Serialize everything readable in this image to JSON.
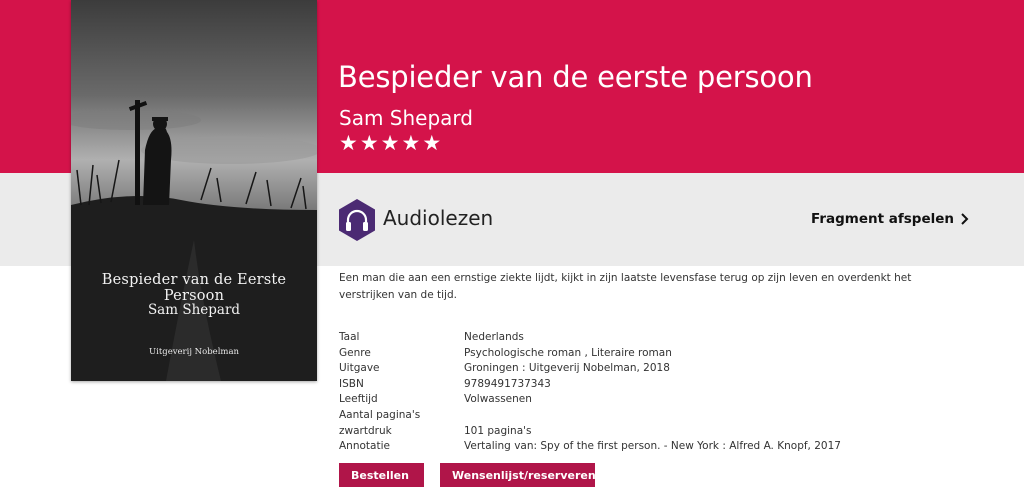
{
  "book": {
    "title": "Bespieder van de eerste persoon",
    "author": "Sam Shepard",
    "rating_stars": 5
  },
  "cover": {
    "title": "Bespieder van de Eerste Persoon",
    "author": "Sam Shepard",
    "publisher": "Uitgeverij Nobelman"
  },
  "audio": {
    "label": "Audiolezen",
    "icon": "headphones-icon",
    "fragment_label": "Fragment afspelen"
  },
  "description": "Een man die aan een ernstige ziekte lijdt, kijkt in zijn laatste levensfase terug op zijn leven en overdenkt het verstrijken van de tijd.",
  "meta": [
    {
      "key": "Taal",
      "value": "Nederlands"
    },
    {
      "key": "Genre",
      "value": "Psychologische roman , Literaire roman"
    },
    {
      "key": "Uitgave",
      "value": "Groningen : Uitgeverij Nobelman, 2018"
    },
    {
      "key": "ISBN",
      "value": "9789491737343"
    },
    {
      "key": "Leeftijd",
      "value": "Volwassenen"
    },
    {
      "key": "Aantal pagina's",
      "value": ""
    },
    {
      "key": "zwartdruk",
      "value": "101 pagina's"
    },
    {
      "key": "Annotatie",
      "value": "Vertaling van: Spy of the first person. - New York : Alfred A. Knopf, 2017"
    }
  ],
  "buttons": {
    "order_label": "Bestellen",
    "wishlist_label": "Wensenlijst/reserveren"
  },
  "colors": {
    "brand": "#d4134a",
    "button": "#b01549",
    "audio_icon": "#4b2a73"
  }
}
